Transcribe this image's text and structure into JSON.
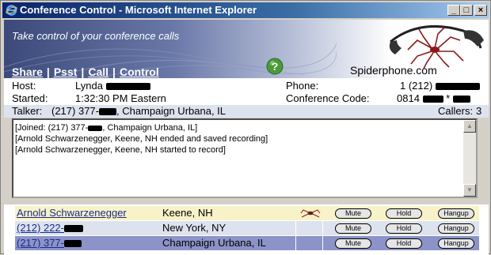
{
  "window": {
    "title": "Conference Control - Microsoft Internet Explorer",
    "buttons": {
      "minimize": "_",
      "maximize": "□",
      "close": "×"
    }
  },
  "banner": {
    "tagline": "Take control of your conference calls",
    "logo_text": "Spiderphone.com",
    "nav": [
      {
        "label": "Share"
      },
      {
        "label": "Psst"
      },
      {
        "label": "Call"
      },
      {
        "label": "Control"
      }
    ],
    "nav_separator": "|"
  },
  "info": {
    "host_label": "Host:",
    "host_value": "Lynda",
    "started_label": "Started:",
    "started_value": "1:32:30 PM Eastern",
    "phone_label": "Phone:",
    "phone_value": "1 (212)",
    "code_label": "Conference Code:",
    "code_value": "0814",
    "code_suffix": "*"
  },
  "talker": {
    "label": "Talker:",
    "value_prefix": "(217) 377-",
    "value_suffix": ", Champaign Urbana, IL",
    "callers_label": "Callers:",
    "callers_count": "3"
  },
  "log": [
    {
      "prefix": "[Joined: (217) 377-",
      "suffix": ", Champaign Urbana, IL]"
    },
    {
      "text": "[Arnold Schwarzenegger, Keene, NH ended and saved recording]"
    },
    {
      "text": "[Arnold Schwarzenegger, Keene, NH started to record]"
    }
  ],
  "participants": [
    {
      "name": "Arnold Schwarzenegger",
      "location": "Keene, NH",
      "mute": "Mute",
      "hold": "Hold",
      "hangup": "Hangup",
      "recording": true
    },
    {
      "name": "(212) 222-",
      "location": "New York, NY",
      "mute": "Mute",
      "hold": "Hold",
      "hangup": "Hangup",
      "recording": false
    },
    {
      "name": "(217) 377-",
      "location": "Champaign Urbana, IL",
      "mute": "Mute",
      "hold": "Hold",
      "hangup": "Hangup",
      "recording": false
    }
  ],
  "colors": {
    "row_highlight": "#f8f2c8",
    "row_normal": "#dde3ee",
    "row_selected": "#8c93c8",
    "title_bar": "#0a246a",
    "help_green": "#4a9a3a",
    "logo_red": "#8a1a1a"
  }
}
